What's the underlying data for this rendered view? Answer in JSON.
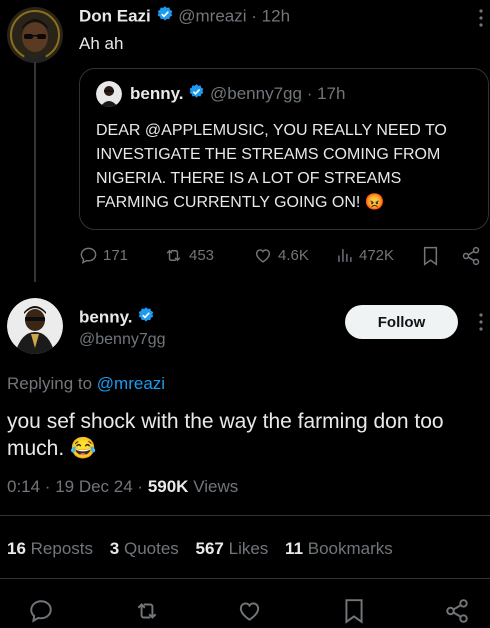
{
  "top_tweet": {
    "display_name": "Don Eazi",
    "handle": "@mreazi",
    "separator": "·",
    "time": "12h",
    "text": "Ah ah",
    "quote": {
      "display_name": "benny.",
      "handle": "@benny7gg",
      "separator": "·",
      "time": "17h",
      "lines": [
        "DEAR @APPLEMUSIC, YOU REALLY NEED TO",
        "INVESTIGATE THE STREAMS COMING FROM",
        "NIGERIA. THERE IS A LOT OF STREAMS",
        "FARMING CURRENTLY GOING ON! 😡"
      ]
    },
    "actions": {
      "replies": "171",
      "reposts": "453",
      "likes": "4.6K",
      "views": "472K"
    }
  },
  "main_tweet": {
    "display_name": "benny.",
    "handle": "@benny7gg",
    "follow_label": "Follow",
    "replying_prefix": "Replying to",
    "replying_handle": "@mreazi",
    "text_line1": "you sef shock with the way the farming don too",
    "text_line2": "much. 😂",
    "meta_time": "0:14 · 19 Dec 24 ·",
    "meta_views_count": "590K",
    "meta_views_label": "Views"
  },
  "stats": {
    "reposts_count": "16",
    "reposts_label": "Reposts",
    "quotes_count": "3",
    "quotes_label": "Quotes",
    "likes_count": "567",
    "likes_label": "Likes",
    "bookmarks_count": "11",
    "bookmarks_label": "Bookmarks"
  },
  "colors": {
    "background": "#000000",
    "accent": "#1d9bf0",
    "muted": "#71767b",
    "text": "#e7e9ea"
  },
  "icons": [
    "more-icon",
    "verified-icon",
    "reply-icon",
    "repost-icon",
    "like-icon",
    "views-icon",
    "bookmark-icon",
    "share-icon"
  ]
}
